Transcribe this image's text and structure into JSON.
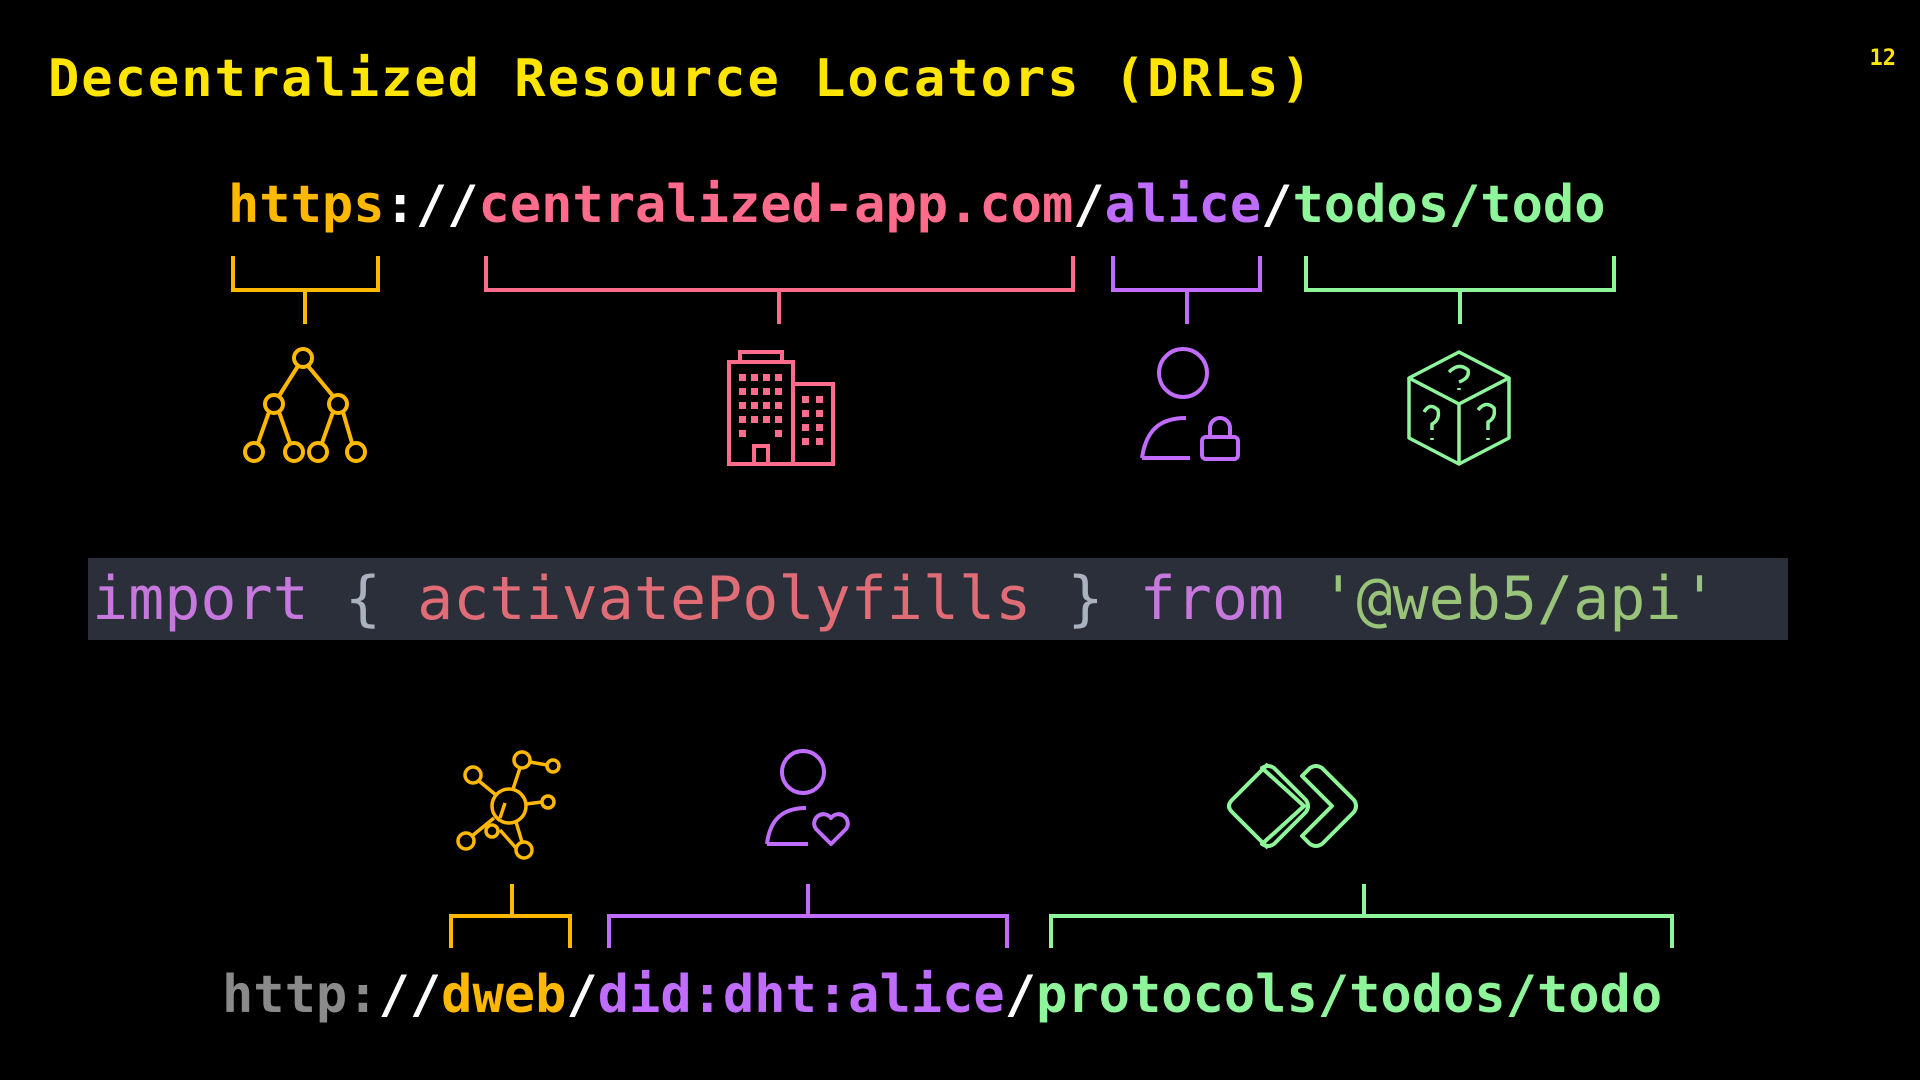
{
  "slide": {
    "title": "Decentralized Resource Locators (DRLs)",
    "page_number": "12"
  },
  "top_url": {
    "scheme": "https",
    "sep1": "://",
    "domain": "centralized-app.com",
    "sep2": "/",
    "user": "alice",
    "sep3": "/",
    "path": "todos/todo"
  },
  "code": {
    "import_kw": "import",
    "open_brace": "{",
    "identifier": "activatePolyfills",
    "close_brace": "}",
    "from_kw": "from",
    "module": "'@web5/api'"
  },
  "bottom_url": {
    "scheme": "http:",
    "sep1": "//",
    "host": "dweb",
    "sep2": "/",
    "did": "did:dht:alice",
    "sep3": "/",
    "path": "protocols/todos/todo"
  },
  "colors": {
    "orange": "#ffb800",
    "pink": "#ff6b8b",
    "purple": "#c06cff",
    "green": "#8ff59a",
    "title_yellow": "#ffe500",
    "code_bg": "#2b2f3a"
  },
  "icons": {
    "top": [
      "hierarchy-tree-icon",
      "office-building-icon",
      "user-lock-icon",
      "mystery-box-icon"
    ],
    "bottom": [
      "network-nodes-icon",
      "user-heart-icon",
      "linked-diamonds-icon"
    ]
  }
}
